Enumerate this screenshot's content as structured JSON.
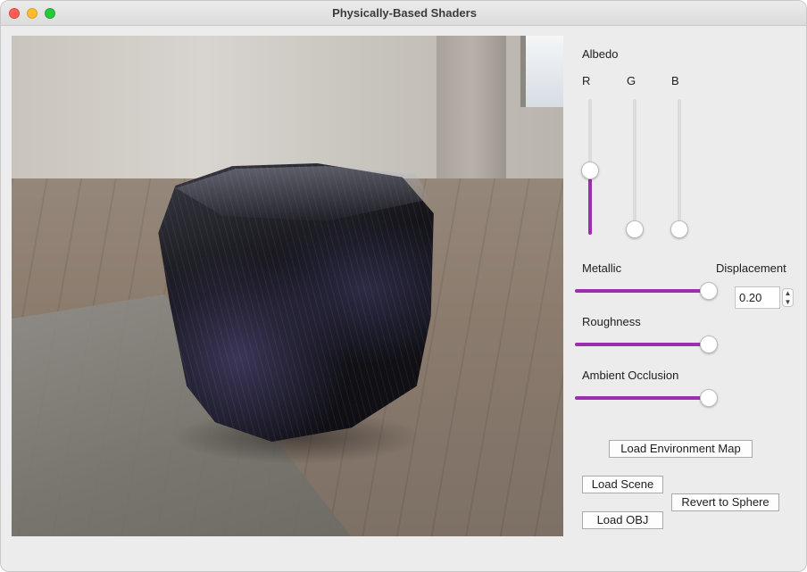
{
  "window": {
    "title": "Physically-Based Shaders"
  },
  "panel": {
    "albedo_label": "Albedo",
    "channels": [
      {
        "label": "R",
        "value": 0.5
      },
      {
        "label": "G",
        "value": 0.0
      },
      {
        "label": "B",
        "value": 0.0
      }
    ],
    "metallic": {
      "label": "Metallic",
      "value": 1.0
    },
    "roughness": {
      "label": "Roughness",
      "value": 1.0
    },
    "ambient_occlusion": {
      "label": "Ambient Occlusion",
      "value": 1.0
    },
    "displacement": {
      "label": "Displacement",
      "value": "0.20"
    },
    "accent_color": "#9a2fb0"
  },
  "buttons": {
    "load_env_map": "Load Environment Map",
    "load_scene": "Load Scene",
    "revert_sphere": "Revert to Sphere",
    "load_obj": "Load OBJ"
  }
}
